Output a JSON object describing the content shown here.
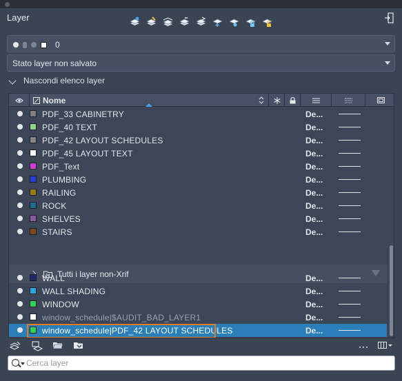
{
  "panel": {
    "title": "Layer"
  },
  "current_layer": {
    "name": "0",
    "color": "#ffffff"
  },
  "layer_state": {
    "value": "Stato layer non salvato"
  },
  "collapse_toggle": {
    "label": "Nascondi elenco layer"
  },
  "table": {
    "column_name_label": "Nome",
    "rows_top": [
      {
        "name": "PDF_33 CABINETRY",
        "color": "#7f7f7f",
        "linetype": "De..."
      },
      {
        "name": "PDF_40 TEXT",
        "color": "#8fd58f",
        "linetype": "De..."
      },
      {
        "name": "PDF_42 LAYOUT SCHEDULES",
        "color": "#888888",
        "linetype": "De..."
      },
      {
        "name": "PDF_45 LAYOUT TEXT",
        "color": "#ffffff",
        "linetype": "De..."
      },
      {
        "name": "PDF_Text",
        "color": "#d43ad4",
        "linetype": "De..."
      },
      {
        "name": "PLUMBING",
        "color": "#2a3fd8",
        "linetype": "De..."
      },
      {
        "name": "RAILING",
        "color": "#9b7b12",
        "linetype": "De..."
      },
      {
        "name": "ROCK",
        "color": "#1b6f8f",
        "linetype": "De..."
      },
      {
        "name": "SHELVES",
        "color": "#8a56a8",
        "linetype": "De..."
      },
      {
        "name": "STAIRS",
        "color": "#7a4a1f",
        "linetype": "De..."
      }
    ],
    "group": {
      "label": "Tutti i layer non-Xrif"
    },
    "rows_bottom": [
      {
        "name": "WALL",
        "color": "#1f2a6e",
        "linetype": "De..."
      },
      {
        "name": "WALL SHADING",
        "color": "#2aa6e0",
        "linetype": "De..."
      },
      {
        "name": "WINDOW",
        "color": "#2fd35a",
        "linetype": "De..."
      },
      {
        "name": "window_schedule|$AUDIT_BAD_LAYER1",
        "color": "#ffffff",
        "linetype": "De..."
      },
      {
        "name": "window_schedule|PDF_42 LAYOUT SCHEDULES",
        "color": "#2fd35a",
        "linetype": "De...",
        "selected": true
      }
    ]
  },
  "search": {
    "placeholder": "Cerca layer"
  },
  "colors": {
    "accent": "#2b7fb8",
    "highlight": "#e07b22",
    "panel_bg": "#3b4453"
  }
}
